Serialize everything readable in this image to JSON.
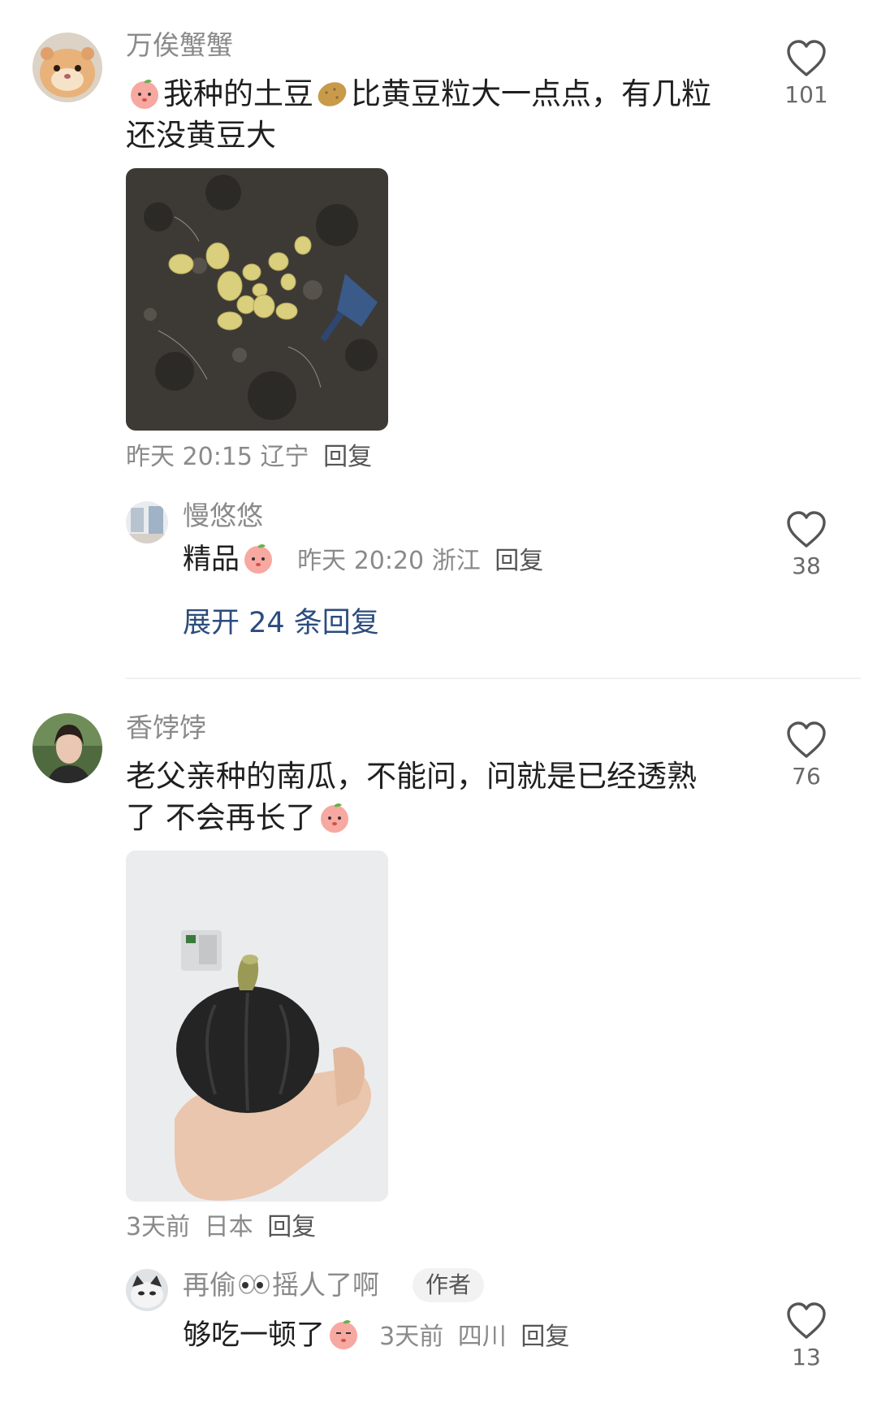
{
  "comments": [
    {
      "username": "万俟蟹蟹",
      "text_a": "我种的土豆",
      "text_b": "比黄豆粒大一点点，有几粒",
      "text_c": "还没黄豆大",
      "time": "昨天 20:15",
      "location": "辽宁",
      "reply_label": "回复",
      "likes": "101",
      "reply": {
        "username": "慢悠悠",
        "text": "精品",
        "time": "昨天 20:20",
        "location": "浙江",
        "reply_label": "回复",
        "likes": "38"
      },
      "expand_label": "展开 24 条回复"
    },
    {
      "username": "香饽饽",
      "text_a": "老父亲种的南瓜，不能问，问就是已经透熟",
      "text_b": "了 不会再长了",
      "time": "3天前",
      "location": "日本",
      "reply_label": "回复",
      "likes": "76",
      "reply": {
        "username_a": "再偷",
        "username_b": "摇人了啊",
        "author_tag": "作者",
        "text": "够吃一顿了",
        "time": "3天前",
        "location": "四川",
        "reply_label": "回复",
        "likes": "13"
      }
    }
  ],
  "icons": {
    "like": "heart-outline-icon",
    "emoji_peach": "peach-face-emoji-icon",
    "emoji_potato": "potato-emoji-icon",
    "emoji_eyes": "eyes-emoji-icon"
  },
  "colors": {
    "expand_link": "#2c4c7d",
    "meta_gray": "#8a8a8a"
  }
}
